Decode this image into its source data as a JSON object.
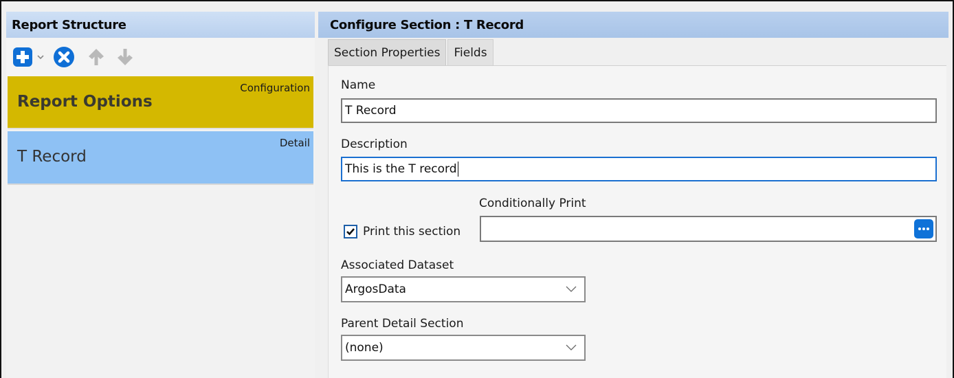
{
  "left": {
    "header": "Report Structure",
    "toolbar": {
      "add_icon": "plus-icon",
      "dropdown_icon": "chevron-down-icon",
      "remove_icon": "remove-circle-icon",
      "up_icon": "arrow-up-icon",
      "down_icon": "arrow-down-icon"
    },
    "items": [
      {
        "title": "Report Options",
        "tag": "Configuration",
        "color": "#d4b800"
      },
      {
        "title": "T Record",
        "tag": "Detail",
        "color": "#8ec1f4"
      }
    ]
  },
  "right": {
    "header": "Configure Section : T Record",
    "tabs": [
      {
        "label": "Section Properties",
        "active": true
      },
      {
        "label": "Fields",
        "active": false
      }
    ],
    "form": {
      "name_label": "Name",
      "name_value": "T Record",
      "description_label": "Description",
      "description_value": "This is the T record",
      "conditionally_print_label": "Conditionally Print",
      "conditionally_print_value": "",
      "print_checkbox_label": "Print this section",
      "print_checked": true,
      "dataset_label": "Associated Dataset",
      "dataset_value": "ArgosData",
      "parent_label": "Parent Detail Section",
      "parent_value": "(none)"
    }
  },
  "colors": {
    "header_bg": "#b9d0ee",
    "accent_blue": "#0f72d8",
    "config_item": "#d4b800",
    "detail_item": "#8ec1f4"
  }
}
